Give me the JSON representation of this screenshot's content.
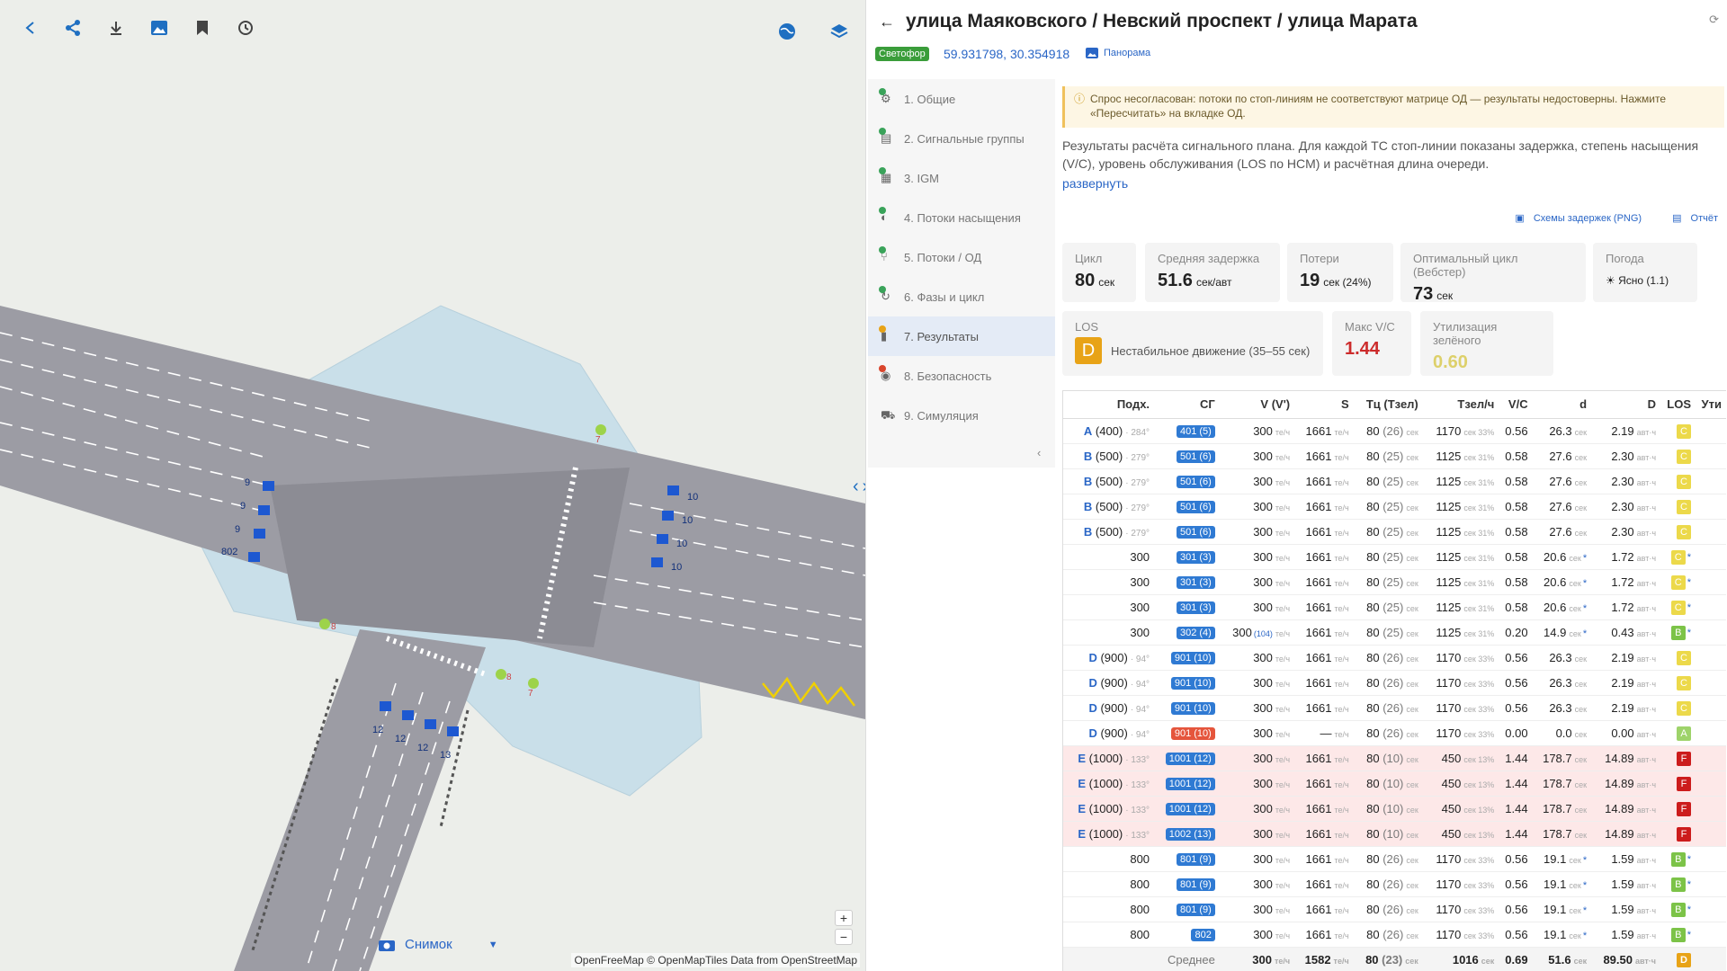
{
  "map": {
    "snapshot_label": "Снимок",
    "attribution": "OpenFreeMap © OpenMapTiles Data from OpenStreetMap",
    "zoom_in": "+",
    "zoom_out": "−",
    "lane_labels": [
      "9",
      "9",
      "9",
      "802",
      "10",
      "10",
      "10",
      "10",
      "12",
      "12",
      "12",
      "13"
    ],
    "ped_labels": [
      "7",
      "8",
      "8",
      "7"
    ]
  },
  "header": {
    "title": "улица Маяковского / Невский проспект / улица Марата",
    "signal_badge": "Светофор",
    "coords": "59.931798, 30.354918",
    "panorama": "Панорама"
  },
  "nav": {
    "items": [
      {
        "label": "1. Общие",
        "dot": "#3aa35a"
      },
      {
        "label": "2. Сигнальные группы",
        "dot": "#3aa35a"
      },
      {
        "label": "3. IGM",
        "dot": "#3aa35a"
      },
      {
        "label": "4. Потоки насыщения",
        "dot": "#3aa35a"
      },
      {
        "label": "5. Потоки / ОД",
        "dot": "#3aa35a"
      },
      {
        "label": "6. Фазы и цикл",
        "dot": "#3aa35a"
      },
      {
        "label": "7. Результаты",
        "dot": "#e8a317",
        "active": true
      },
      {
        "label": "8. Безопасность",
        "dot": "#d9452c"
      },
      {
        "label": "9. Симуляция",
        "dot": ""
      }
    ]
  },
  "warning": "Спрос несогласован: потоки по стоп-линиям не соответствуют матрице ОД — результаты недостоверны. Нажмите «Пересчитать» на вкладке ОД.",
  "description": "Результаты расчёта сигнального плана. Для каждой ТС стоп-линии показаны задержка, степень насыщения (V/C), уровень обслуживания (LOS по HCM) и расчётная длина очереди.",
  "expand_label": "развернуть",
  "links": {
    "delays": "Схемы задержек (PNG)",
    "report": "Отчёт"
  },
  "cards": {
    "cycle": {
      "label": "Цикл",
      "value": "80",
      "unit": "сек"
    },
    "delay": {
      "label": "Средняя задержка",
      "value": "51.6",
      "unit": "сек/авт"
    },
    "loss": {
      "label": "Потери",
      "value": "19",
      "unit": "сек (24%)"
    },
    "optimal": {
      "label": "Оптимальный цикл (Вебстер)",
      "value": "73",
      "unit": "сек"
    },
    "weather": {
      "label": "Погода",
      "value": "Ясно (1.1)"
    },
    "los": {
      "label": "LOS",
      "grade": "D",
      "text": "Нестабильное движение (35–55 сек)"
    },
    "maxvc": {
      "label": "Макс V/C",
      "value": "1.44"
    },
    "green": {
      "label": "Утилизация зелёного",
      "value": "0.60"
    }
  },
  "table": {
    "headers": [
      "Подх.",
      "СГ",
      "V (V')",
      "S",
      "Тц (Тзел)",
      "Тзел/ч",
      "V/C",
      "d",
      "D",
      "LOS",
      "Ути"
    ],
    "rows": [
      {
        "app": "A",
        "appn": "(400)",
        "az": "284°",
        "sg": "401 (5)",
        "v": "300",
        "s": "1661",
        "tc": "80",
        "tg": "(26)",
        "tz": "1170",
        "pct": "33%",
        "vc": "0.56",
        "d": "26.3",
        "D": "2.19",
        "los": "C",
        "star": false
      },
      {
        "app": "B",
        "appn": "(500)",
        "az": "279°",
        "sg": "501 (6)",
        "v": "300",
        "s": "1661",
        "tc": "80",
        "tg": "(25)",
        "tz": "1125",
        "pct": "31%",
        "vc": "0.58",
        "d": "27.6",
        "D": "2.30",
        "los": "C",
        "star": false
      },
      {
        "app": "B",
        "appn": "(500)",
        "az": "279°",
        "sg": "501 (6)",
        "v": "300",
        "s": "1661",
        "tc": "80",
        "tg": "(25)",
        "tz": "1125",
        "pct": "31%",
        "vc": "0.58",
        "d": "27.6",
        "D": "2.30",
        "los": "C",
        "star": false
      },
      {
        "app": "B",
        "appn": "(500)",
        "az": "279°",
        "sg": "501 (6)",
        "v": "300",
        "s": "1661",
        "tc": "80",
        "tg": "(25)",
        "tz": "1125",
        "pct": "31%",
        "vc": "0.58",
        "d": "27.6",
        "D": "2.30",
        "los": "C",
        "star": false
      },
      {
        "app": "B",
        "appn": "(500)",
        "az": "279°",
        "sg": "501 (6)",
        "v": "300",
        "s": "1661",
        "tc": "80",
        "tg": "(25)",
        "tz": "1125",
        "pct": "31%",
        "vc": "0.58",
        "d": "27.6",
        "D": "2.30",
        "los": "C",
        "star": false
      },
      {
        "app": "",
        "appn": "300",
        "az": "",
        "sg": "301 (3)",
        "v": "300",
        "s": "1661",
        "tc": "80",
        "tg": "(25)",
        "tz": "1125",
        "pct": "31%",
        "vc": "0.58",
        "d": "20.6",
        "D": "1.72",
        "los": "C",
        "star": true
      },
      {
        "app": "",
        "appn": "300",
        "az": "",
        "sg": "301 (3)",
        "v": "300",
        "s": "1661",
        "tc": "80",
        "tg": "(25)",
        "tz": "1125",
        "pct": "31%",
        "vc": "0.58",
        "d": "20.6",
        "D": "1.72",
        "los": "C",
        "star": true
      },
      {
        "app": "",
        "appn": "300",
        "az": "",
        "sg": "301 (3)",
        "v": "300",
        "s": "1661",
        "tc": "80",
        "tg": "(25)",
        "tz": "1125",
        "pct": "31%",
        "vc": "0.58",
        "d": "20.6",
        "D": "1.72",
        "los": "C",
        "star": true
      },
      {
        "app": "",
        "appn": "300",
        "az": "",
        "sg": "302 (4)",
        "v": "300",
        "vp": "(104)",
        "s": "1661",
        "tc": "80",
        "tg": "(25)",
        "tz": "1125",
        "pct": "31%",
        "vc": "0.20",
        "d": "14.9",
        "D": "0.43",
        "los": "B",
        "star": true
      },
      {
        "app": "D",
        "appn": "(900)",
        "az": "94°",
        "sg": "901 (10)",
        "v": "300",
        "s": "1661",
        "tc": "80",
        "tg": "(26)",
        "tz": "1170",
        "pct": "33%",
        "vc": "0.56",
        "d": "26.3",
        "D": "2.19",
        "los": "C",
        "star": false
      },
      {
        "app": "D",
        "appn": "(900)",
        "az": "94°",
        "sg": "901 (10)",
        "v": "300",
        "s": "1661",
        "tc": "80",
        "tg": "(26)",
        "tz": "1170",
        "pct": "33%",
        "vc": "0.56",
        "d": "26.3",
        "D": "2.19",
        "los": "C",
        "star": false
      },
      {
        "app": "D",
        "appn": "(900)",
        "az": "94°",
        "sg": "901 (10)",
        "v": "300",
        "s": "1661",
        "tc": "80",
        "tg": "(26)",
        "tz": "1170",
        "pct": "33%",
        "vc": "0.56",
        "d": "26.3",
        "D": "2.19",
        "los": "C",
        "star": false
      },
      {
        "app": "D",
        "appn": "(900)",
        "az": "94°",
        "sg": "901 (10)",
        "sgred": true,
        "v": "300",
        "s": "—",
        "tc": "80",
        "tg": "(26)",
        "tz": "1170",
        "pct": "33%",
        "vc": "0.00",
        "d": "0.0",
        "D": "0.00",
        "los": "A",
        "star": false
      },
      {
        "app": "E",
        "appn": "(1000)",
        "az": "133°",
        "sg": "1001 (12)",
        "v": "300",
        "s": "1661",
        "tc": "80",
        "tg": "(10)",
        "tz": "450",
        "pct": "13%",
        "vc": "1.44",
        "d": "178.7",
        "D": "14.89",
        "los": "F",
        "star": false,
        "hi": true
      },
      {
        "app": "E",
        "appn": "(1000)",
        "az": "133°",
        "sg": "1001 (12)",
        "v": "300",
        "s": "1661",
        "tc": "80",
        "tg": "(10)",
        "tz": "450",
        "pct": "13%",
        "vc": "1.44",
        "d": "178.7",
        "D": "14.89",
        "los": "F",
        "star": false,
        "hi": true
      },
      {
        "app": "E",
        "appn": "(1000)",
        "az": "133°",
        "sg": "1001 (12)",
        "v": "300",
        "s": "1661",
        "tc": "80",
        "tg": "(10)",
        "tz": "450",
        "pct": "13%",
        "vc": "1.44",
        "d": "178.7",
        "D": "14.89",
        "los": "F",
        "star": false,
        "hi": true
      },
      {
        "app": "E",
        "appn": "(1000)",
        "az": "133°",
        "sg": "1002 (13)",
        "v": "300",
        "s": "1661",
        "tc": "80",
        "tg": "(10)",
        "tz": "450",
        "pct": "13%",
        "vc": "1.44",
        "d": "178.7",
        "D": "14.89",
        "los": "F",
        "star": false,
        "hi": true
      },
      {
        "app": "",
        "appn": "800",
        "az": "",
        "sg": "801 (9)",
        "v": "300",
        "s": "1661",
        "tc": "80",
        "tg": "(26)",
        "tz": "1170",
        "pct": "33%",
        "vc": "0.56",
        "d": "19.1",
        "D": "1.59",
        "los": "B",
        "star": true
      },
      {
        "app": "",
        "appn": "800",
        "az": "",
        "sg": "801 (9)",
        "v": "300",
        "s": "1661",
        "tc": "80",
        "tg": "(26)",
        "tz": "1170",
        "pct": "33%",
        "vc": "0.56",
        "d": "19.1",
        "D": "1.59",
        "los": "B",
        "star": true
      },
      {
        "app": "",
        "appn": "800",
        "az": "",
        "sg": "801 (9)",
        "v": "300",
        "s": "1661",
        "tc": "80",
        "tg": "(26)",
        "tz": "1170",
        "pct": "33%",
        "vc": "0.56",
        "d": "19.1",
        "D": "1.59",
        "los": "B",
        "star": true
      },
      {
        "app": "",
        "appn": "800",
        "az": "",
        "sg": "802",
        "v": "300",
        "s": "1661",
        "tc": "80",
        "tg": "(26)",
        "tz": "1170",
        "pct": "33%",
        "vc": "0.56",
        "d": "19.1",
        "D": "1.59",
        "los": "B",
        "star": true
      }
    ],
    "avg": {
      "label": "Среднее",
      "v": "300",
      "s": "1582",
      "tc": "80",
      "tg": "(23)",
      "tz": "1016",
      "vc": "0.69",
      "d": "51.6",
      "D": "89.50",
      "los": "D"
    },
    "units": {
      "v": "те/ч",
      "s": "те/ч",
      "tc": "сек",
      "tz": "сек",
      "d": "сек",
      "D": "авт·ч"
    }
  }
}
